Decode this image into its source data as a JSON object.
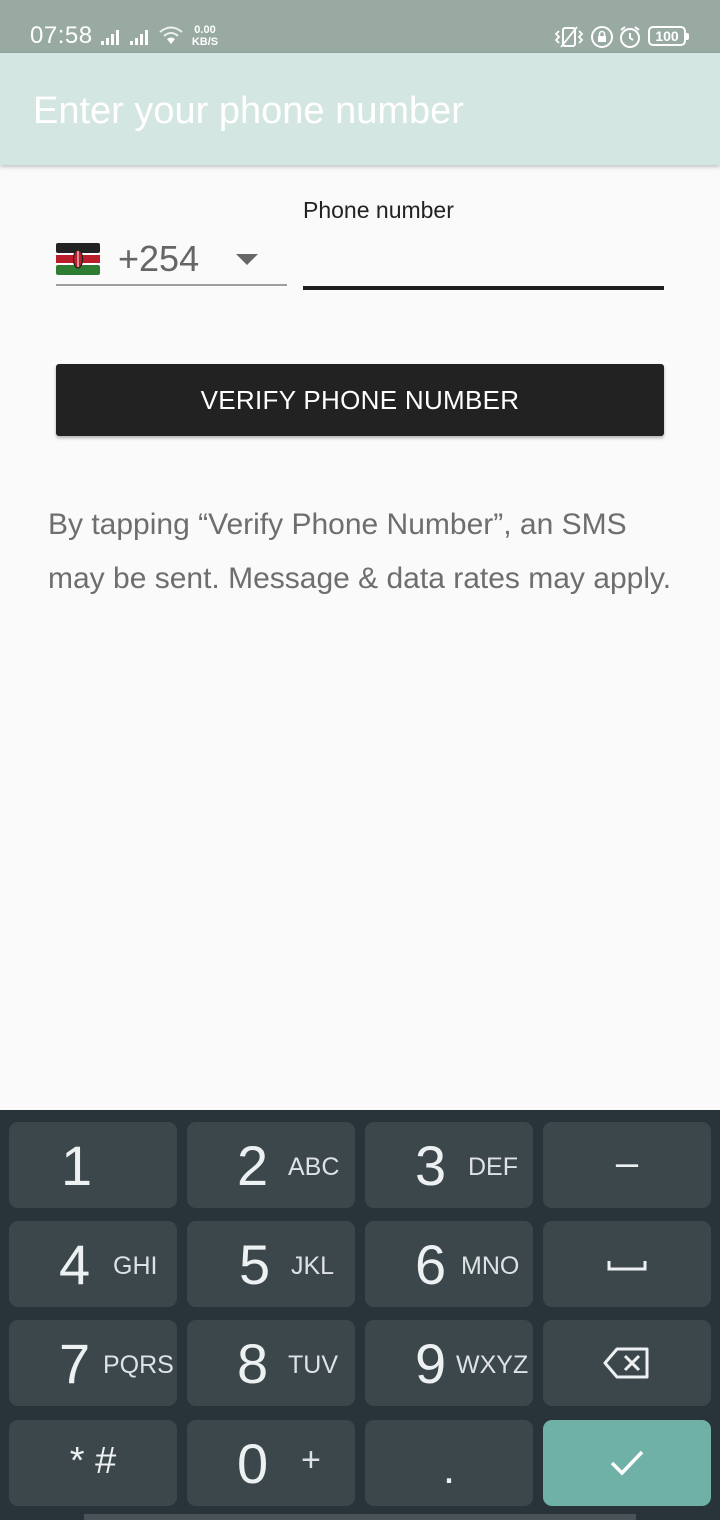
{
  "status_bar": {
    "time": "07:58",
    "net_speed_value": "0.00",
    "net_speed_unit": "KB/S",
    "battery": "100",
    "icons": [
      "signal-icon",
      "signal-icon",
      "wifi-icon",
      "vibrate-icon",
      "rotation-lock-icon",
      "alarm-icon",
      "battery-icon"
    ]
  },
  "app_bar": {
    "title": "Enter your phone number"
  },
  "form": {
    "country_flag": "kenya-flag-icon",
    "country_code": "+254",
    "phone_label": "Phone number",
    "phone_value": "",
    "verify_button": "VERIFY PHONE NUMBER"
  },
  "disclaimer": "By tapping “Verify Phone Number”, an SMS may be sent. Message & data rates may apply.",
  "keypad": {
    "keys": [
      {
        "digit": "1",
        "letters": ""
      },
      {
        "digit": "2",
        "letters": "ABC"
      },
      {
        "digit": "3",
        "letters": "DEF"
      },
      {
        "symbol": "–"
      },
      {
        "digit": "4",
        "letters": "GHI"
      },
      {
        "digit": "5",
        "letters": "JKL"
      },
      {
        "digit": "6",
        "letters": "MNO"
      },
      {
        "symbol": "space"
      },
      {
        "digit": "7",
        "letters": "PQRS"
      },
      {
        "digit": "8",
        "letters": "TUV"
      },
      {
        "digit": "9",
        "letters": "WXYZ"
      },
      {
        "symbol": "backspace"
      },
      {
        "symbol": "* #"
      },
      {
        "digit": "0",
        "letters": "+"
      },
      {
        "symbol": "."
      },
      {
        "symbol": "done"
      }
    ]
  },
  "colors": {
    "status_bar": "#98aaa2",
    "app_bar": "#d4e6e1",
    "button": "#222222",
    "keypad_bg": "#29343a",
    "key": "#3c474c",
    "done_key": "#6fb0a7"
  }
}
